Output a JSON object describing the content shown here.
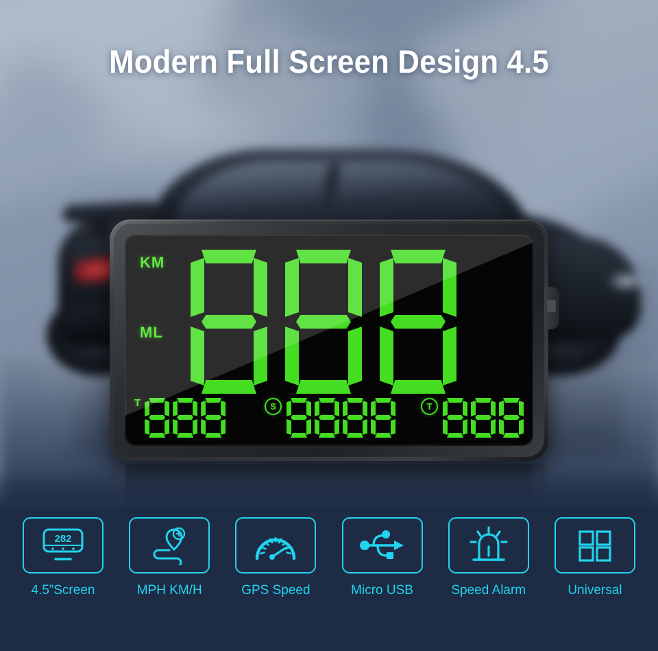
{
  "headline": "Modern Full Screen Design 4.5",
  "colors": {
    "accent_cyan": "#22d3ee",
    "led_green": "#44dd22",
    "panel_navy": "#1d2b44",
    "title_white": "#ffffff",
    "bezel_dark": "#2b2e31"
  },
  "hud": {
    "unit_primary": "KM",
    "unit_secondary": "ML",
    "main_display": "888",
    "main_digits": [
      "8",
      "8",
      "8"
    ],
    "bottom_groups": [
      {
        "tag": "T",
        "tag_style": "plain",
        "value": "888",
        "digits": [
          "8",
          "8",
          "8"
        ]
      },
      {
        "tag": "S",
        "tag_style": "circled",
        "value": "8888",
        "digits": [
          "8",
          "8",
          "8",
          "8"
        ]
      },
      {
        "tag": "T",
        "tag_style": "circled",
        "value": "888",
        "digits": [
          "8",
          "8",
          "8"
        ]
      }
    ]
  },
  "features": [
    {
      "label": "4.5”Screen",
      "icon": "screen-icon",
      "icon_value": "282"
    },
    {
      "label": "MPH KM/H",
      "icon": "route-pin-icon"
    },
    {
      "label": "GPS Speed",
      "icon": "speedometer-icon"
    },
    {
      "label": "Micro USB",
      "icon": "usb-icon"
    },
    {
      "label": "Speed Alarm",
      "icon": "siren-icon"
    },
    {
      "label": "Universal",
      "icon": "grid-icon"
    }
  ]
}
